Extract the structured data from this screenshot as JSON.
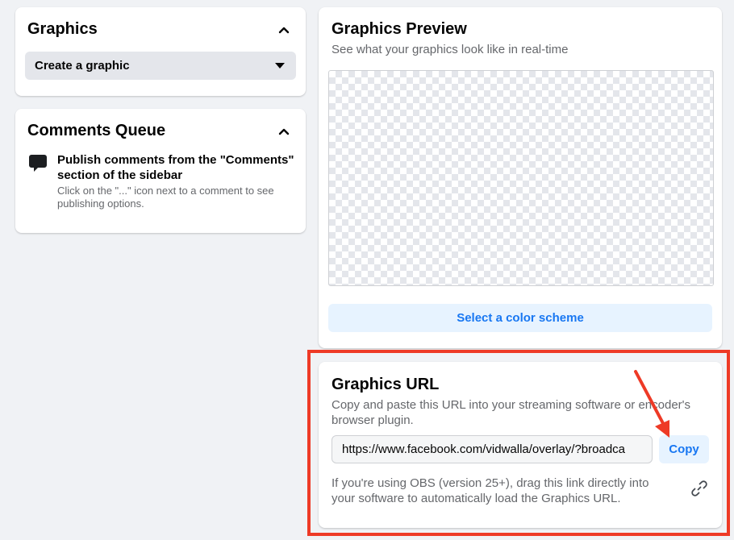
{
  "graphics": {
    "title": "Graphics",
    "dropdown_label": "Create a graphic"
  },
  "comments_queue": {
    "title": "Comments Queue",
    "main_text": "Publish comments from the \"Comments\" section of the sidebar",
    "sub_text": "Click on the \"...\" icon next to a comment to see publishing options."
  },
  "preview": {
    "title": "Graphics Preview",
    "subtitle": "See what your graphics look like in real-time",
    "color_scheme_button": "Select a color scheme"
  },
  "graphics_url": {
    "title": "Graphics URL",
    "description": "Copy and paste this URL into your streaming software or encoder's browser plugin.",
    "url_value": "https://www.facebook.com/vidwalla/overlay/?broadca",
    "copy_label": "Copy",
    "obs_note": "If you're using OBS (version 25+), drag this link directly into your software to automatically load the Graphics URL."
  },
  "colors": {
    "accent": "#1877f2",
    "highlight": "#ee3a26",
    "background": "#f0f2f5"
  },
  "icons": {
    "collapse": "chevron-up-icon",
    "dropdown": "caret-down-icon",
    "comment": "speech-bubble-icon",
    "link": "link-icon"
  }
}
